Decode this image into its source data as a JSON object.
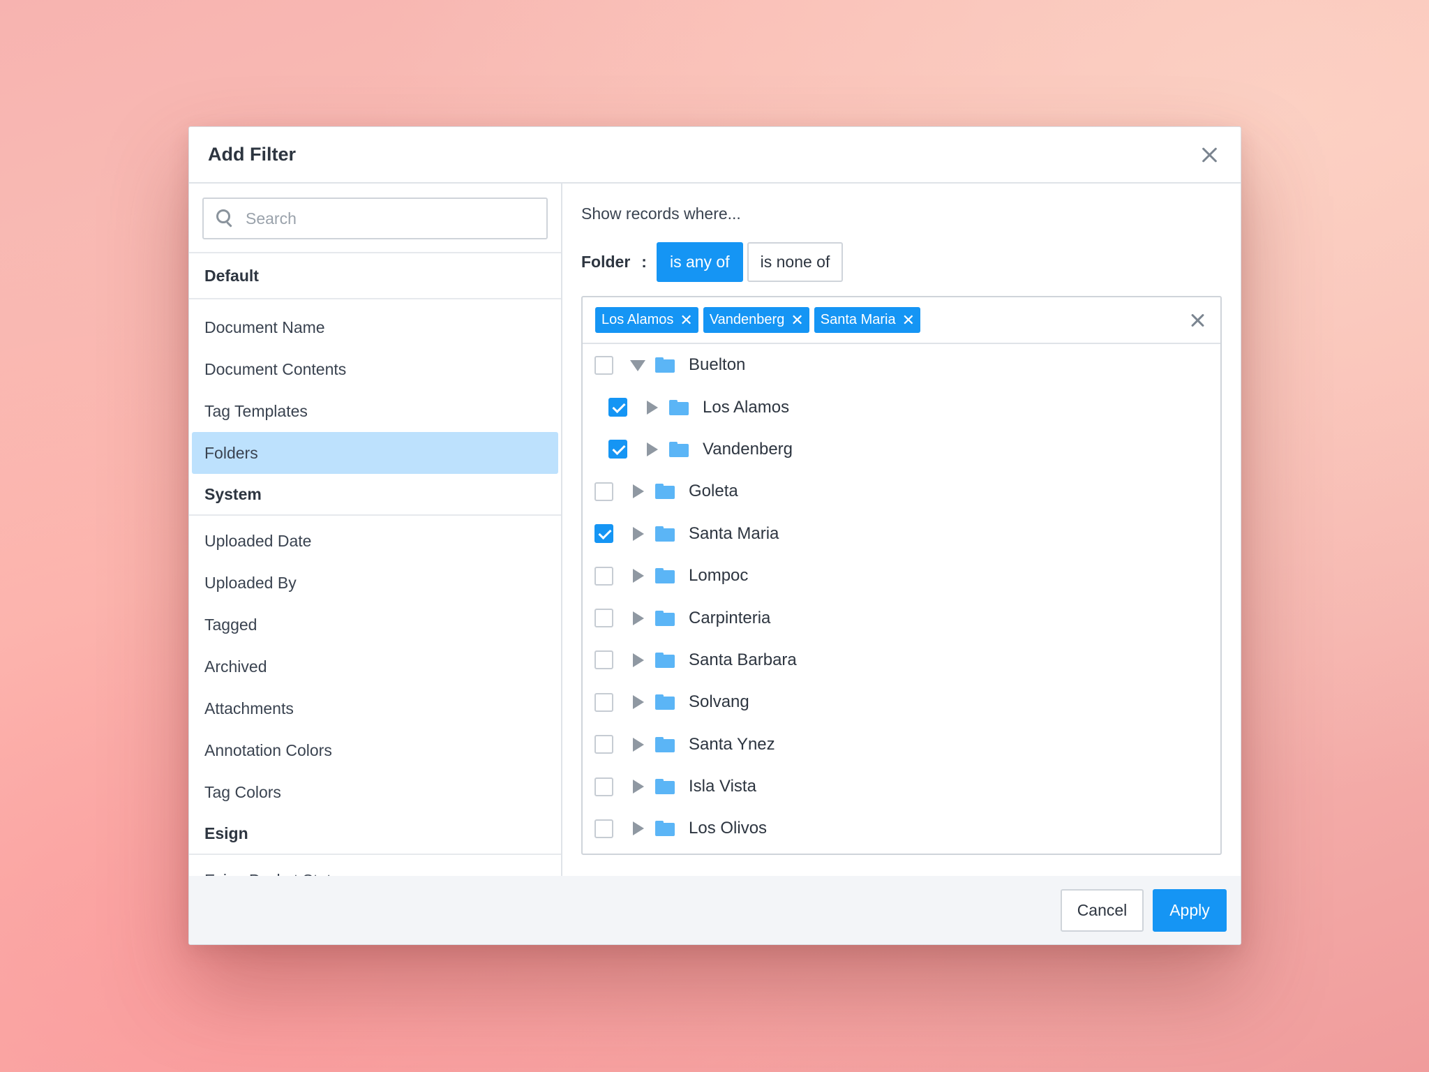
{
  "modal": {
    "title": "Add Filter"
  },
  "search": {
    "placeholder": "Search",
    "value": ""
  },
  "field_groups": [
    {
      "name": "Default",
      "items": [
        "Document Name",
        "Document Contents",
        "Tag Templates",
        "Folders"
      ]
    },
    {
      "name": "System",
      "items": [
        "Uploaded Date",
        "Uploaded By",
        "Tagged",
        "Archived",
        "Attachments",
        "Annotation Colors",
        "Tag Colors"
      ]
    },
    {
      "name": "Esign",
      "items": [
        "Esign Packet Status"
      ]
    }
  ],
  "selected_field": "Folders",
  "condition": {
    "intro": "Show records where...",
    "field_label": "Folder",
    "colon": ":",
    "op_any": "is any of",
    "op_none": "is none of",
    "active_op": "is any of"
  },
  "chips": [
    {
      "label": "Los Alamos",
      "remove": "✕"
    },
    {
      "label": "Vandenberg",
      "remove": "✕"
    },
    {
      "label": "Santa Maria",
      "remove": "✕"
    }
  ],
  "tree": [
    {
      "label": "Buelton",
      "checked": false,
      "expanded": true,
      "depth": 0
    },
    {
      "label": "Los Alamos",
      "checked": true,
      "expanded": false,
      "depth": 1
    },
    {
      "label": "Vandenberg",
      "checked": true,
      "expanded": false,
      "depth": 1
    },
    {
      "label": "Goleta",
      "checked": false,
      "expanded": false,
      "depth": 0
    },
    {
      "label": "Santa Maria",
      "checked": true,
      "expanded": false,
      "depth": 0
    },
    {
      "label": "Lompoc",
      "checked": false,
      "expanded": false,
      "depth": 0
    },
    {
      "label": "Carpinteria",
      "checked": false,
      "expanded": false,
      "depth": 0
    },
    {
      "label": "Santa Barbara",
      "checked": false,
      "expanded": false,
      "depth": 0
    },
    {
      "label": "Solvang",
      "checked": false,
      "expanded": false,
      "depth": 0
    },
    {
      "label": "Santa Ynez",
      "checked": false,
      "expanded": false,
      "depth": 0
    },
    {
      "label": "Isla Vista",
      "checked": false,
      "expanded": false,
      "depth": 0
    },
    {
      "label": "Los Olivos",
      "checked": false,
      "expanded": false,
      "depth": 0
    }
  ],
  "footer": {
    "cancel_label": "Cancel",
    "apply_label": "Apply"
  },
  "colors": {
    "accent": "#1595f4",
    "selected_row": "#bde1fd",
    "folder": "#5bb5f6"
  },
  "icons": {
    "close": "close-icon",
    "search": "search-icon",
    "folder": "folder-icon",
    "caret_right": "caret-right-icon",
    "caret_down": "caret-down-icon",
    "check": "checkmark-icon"
  }
}
